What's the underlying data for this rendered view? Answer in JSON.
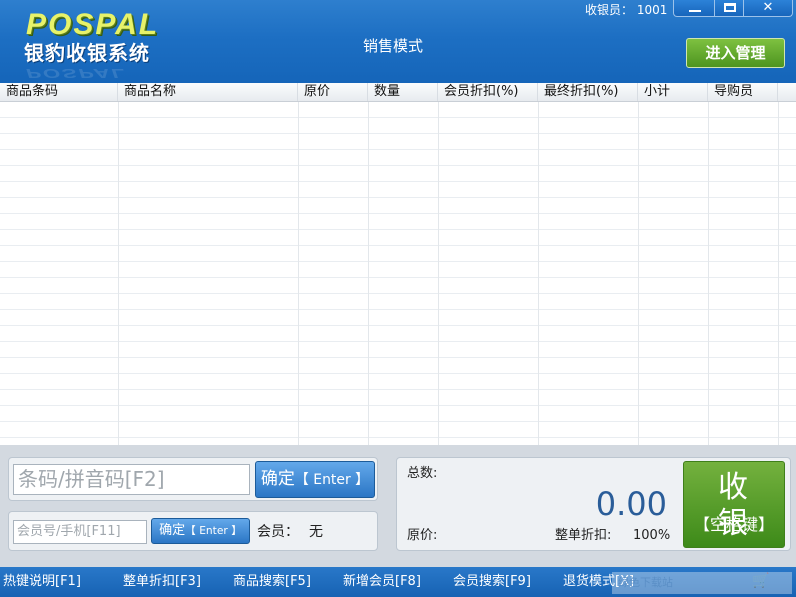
{
  "header": {
    "logo_en": "POSPAL",
    "logo_cn": "银豹收银系统",
    "mode_title": "销售模式",
    "cashier": "收银员： 1001",
    "enter_management": "进入管理"
  },
  "window_controls": {
    "minimize": "minimize-icon",
    "maximize": "maximize-icon",
    "close": "✕"
  },
  "grid": {
    "columns": [
      "商品条码",
      "商品名称",
      "原价",
      "数量",
      "会员折扣(%)",
      "最终折扣(%)",
      "小计",
      "导购员"
    ],
    "rows": []
  },
  "input_panel": {
    "barcode_placeholder": "条码/拼音码[F2]",
    "confirm_label": "确定",
    "confirm_key": "【 Enter 】",
    "member_placeholder": "会员号/手机[F11]",
    "member_confirm_label": "确定",
    "member_confirm_key": "【 Enter 】",
    "member_label": "会员：",
    "member_value": "无"
  },
  "summary": {
    "total_label": "总数:",
    "total_value": "0.00",
    "original_price_label": "原价:",
    "discount_label": "整单折扣:",
    "discount_value": "100%"
  },
  "checkout": {
    "label": "收 银",
    "key": "【空格键】"
  },
  "statusbar": {
    "hotkeys": [
      "热键说明[F1]",
      "整单折扣[F3]",
      "商品搜索[F5]",
      "新增会员[F8]",
      "会员搜索[F9]",
      "退货模式[X]"
    ],
    "watermark": "绿色下载站"
  },
  "colors": {
    "header_blue": "#1d6fc3",
    "accent_green": "#4d9420",
    "confirm_blue": "#2b76c5",
    "total_blue": "#2a5d99"
  }
}
